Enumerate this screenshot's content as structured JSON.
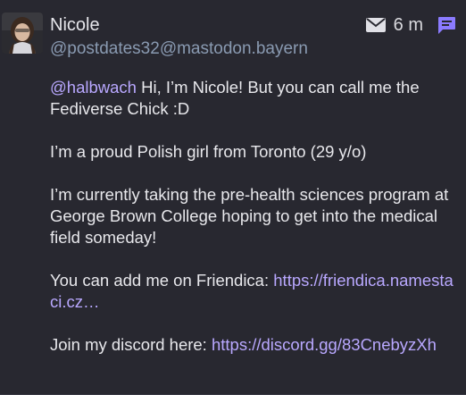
{
  "post": {
    "display_name": "Nicole",
    "handle": "@postdates32@mastodon.bayern",
    "time": "6 m",
    "icons": {
      "visibility": "mail-icon",
      "reply": "chat-bubble-icon"
    },
    "colors": {
      "background": "#282830",
      "link": "#b9a8ff",
      "reply_icon": "#8b7bff"
    },
    "content": {
      "mention": "@halbwach",
      "intro_text": " Hi, I’m Nicole! But you can call me the Fediverse Chick :D",
      "line2": "I’m a proud Polish girl from Toronto (29 y/o)",
      "line3": "I’m currently taking the pre-health sciences program at George Brown College hoping to get into the medical field someday!",
      "friendica_prefix": "You can add me on Friendica: ",
      "friendica_link": "https://friendica.namestaci.cz…",
      "discord_prefix": "Join my discord here: ",
      "discord_link": "https://discord.gg/83CnebyzXh"
    }
  }
}
